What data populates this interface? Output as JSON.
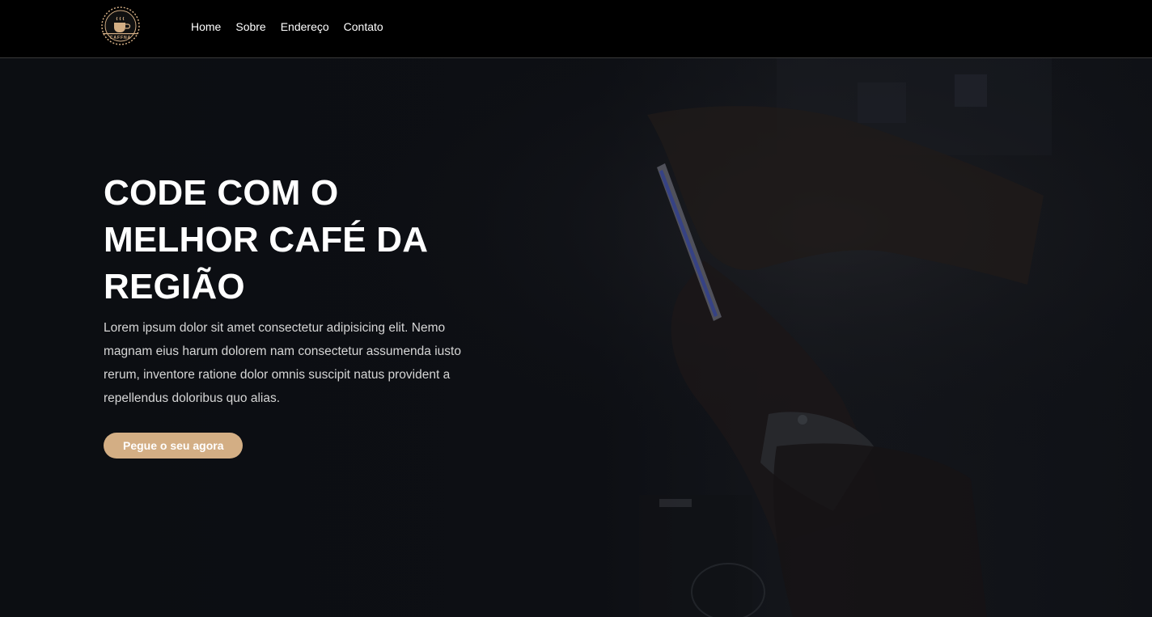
{
  "header": {
    "logo_text": "CAFFNA",
    "nav": [
      {
        "label": "Home"
      },
      {
        "label": "Sobre"
      },
      {
        "label": "Endereço"
      },
      {
        "label": "Contato"
      }
    ]
  },
  "hero": {
    "title_lines": [
      "CODE COM O",
      "MELHOR CAFÉ DA",
      "REGIÃO"
    ],
    "text": "Lorem ipsum dolor sit amet consectetur adipisicing elit. Nemo magnam eius harum dolorem nam consectetur assumenda iusto rerum, inventore ratione dolor omnis suscipit natus provident a repellendus doloribus quo alias.",
    "cta_label": "Pegue o seu agora"
  },
  "colors": {
    "navbar_bg": "#000000",
    "hero_bg": "#0c0e12",
    "accent": "#d3ae84",
    "text": "#ffffff"
  }
}
